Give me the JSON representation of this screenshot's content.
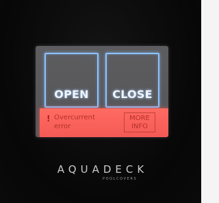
{
  "buttons": {
    "open_label": "OPEN",
    "close_label": "CLOSE"
  },
  "error": {
    "icon": "exclamation-icon",
    "icon_glyph": "!",
    "message_line1": "Overcurrent",
    "message_line2": "error",
    "more_info_line1": "MORE",
    "more_info_line2": "INFO"
  },
  "brand": {
    "name": "AQUADECK",
    "tagline": "POOLCOVERS"
  },
  "colors": {
    "accent_blue": "#8ec2ff",
    "error_red": "#f45a55",
    "background": "#070707"
  }
}
